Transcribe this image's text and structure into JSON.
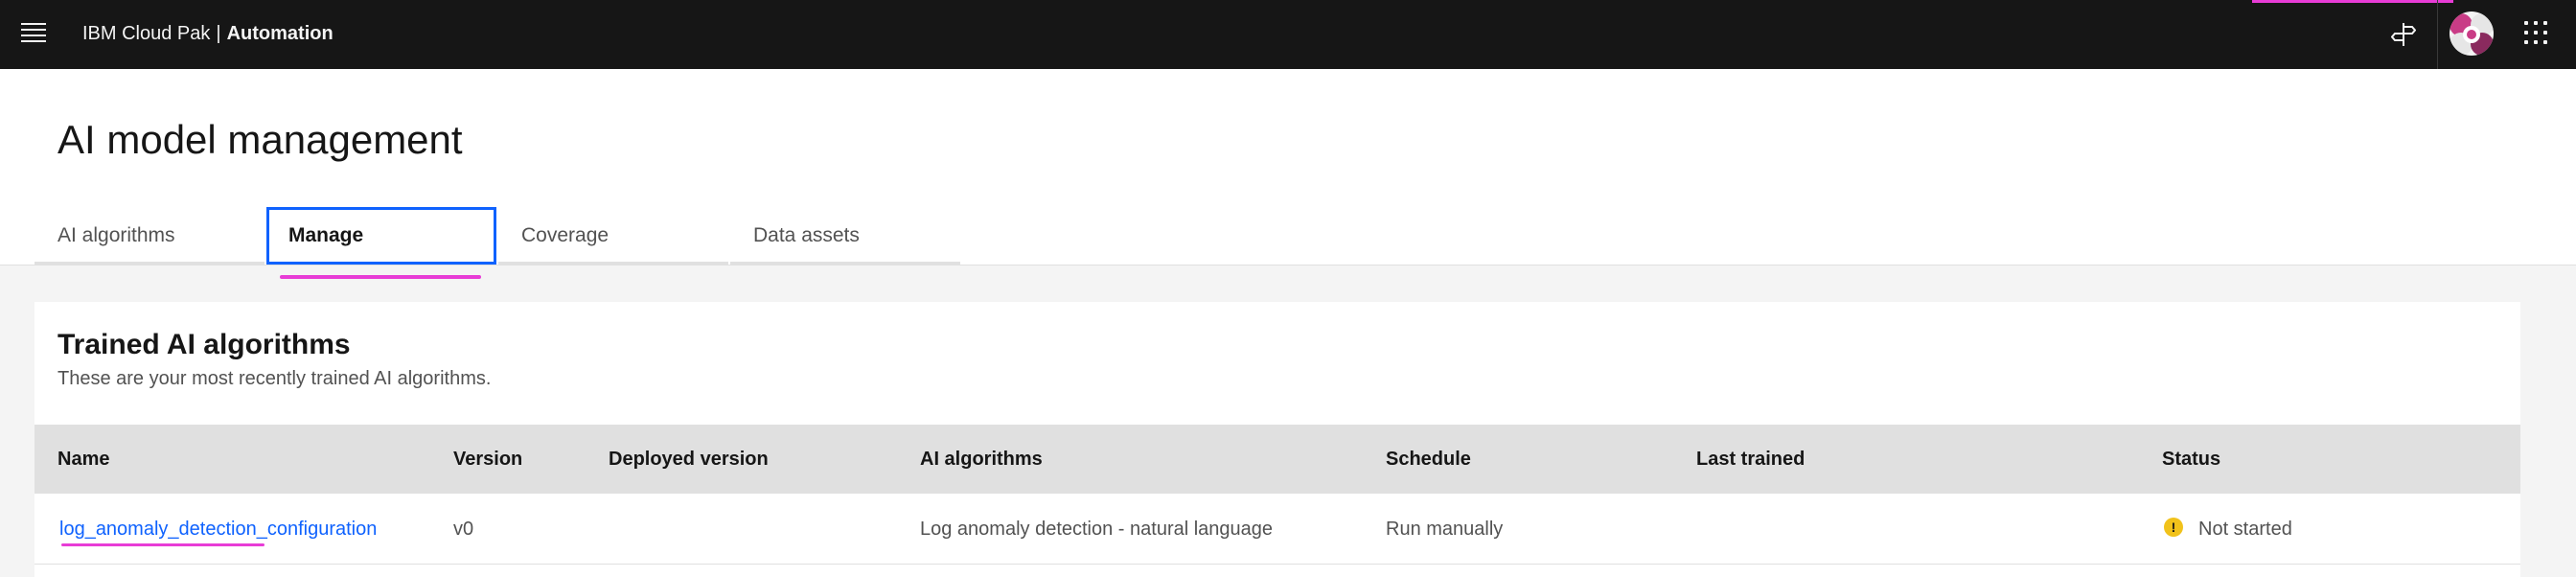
{
  "header": {
    "brand_prefix": "IBM Cloud Pak",
    "brand_separator": "|",
    "brand_product": "Automation",
    "icons": [
      "menu-icon",
      "signpost-icon",
      "avatar",
      "app-switcher-icon"
    ]
  },
  "page": {
    "title": "AI model management"
  },
  "tabs": [
    {
      "label": "AI algorithms",
      "selected": false
    },
    {
      "label": "Manage",
      "selected": true
    },
    {
      "label": "Coverage",
      "selected": false
    },
    {
      "label": "Data assets",
      "selected": false
    }
  ],
  "card": {
    "title": "Trained AI algorithms",
    "subtitle": "These are your most recently trained AI algorithms."
  },
  "table": {
    "columns": [
      "Name",
      "Version",
      "Deployed version",
      "AI algorithms",
      "Schedule",
      "Last trained",
      "Status"
    ],
    "rows": [
      {
        "name": "log_anomaly_detection_configuration",
        "version": "v0",
        "deployed_version": "",
        "ai_algorithms": "Log anomaly detection - natural language",
        "schedule": "Run manually",
        "last_trained": "",
        "status": "Not started"
      }
    ]
  },
  "colors": {
    "header_bg": "#161616",
    "accent_blue": "#0f62fe",
    "highlight_magenta": "#e83cd6",
    "warning_yellow": "#f1c21b"
  }
}
